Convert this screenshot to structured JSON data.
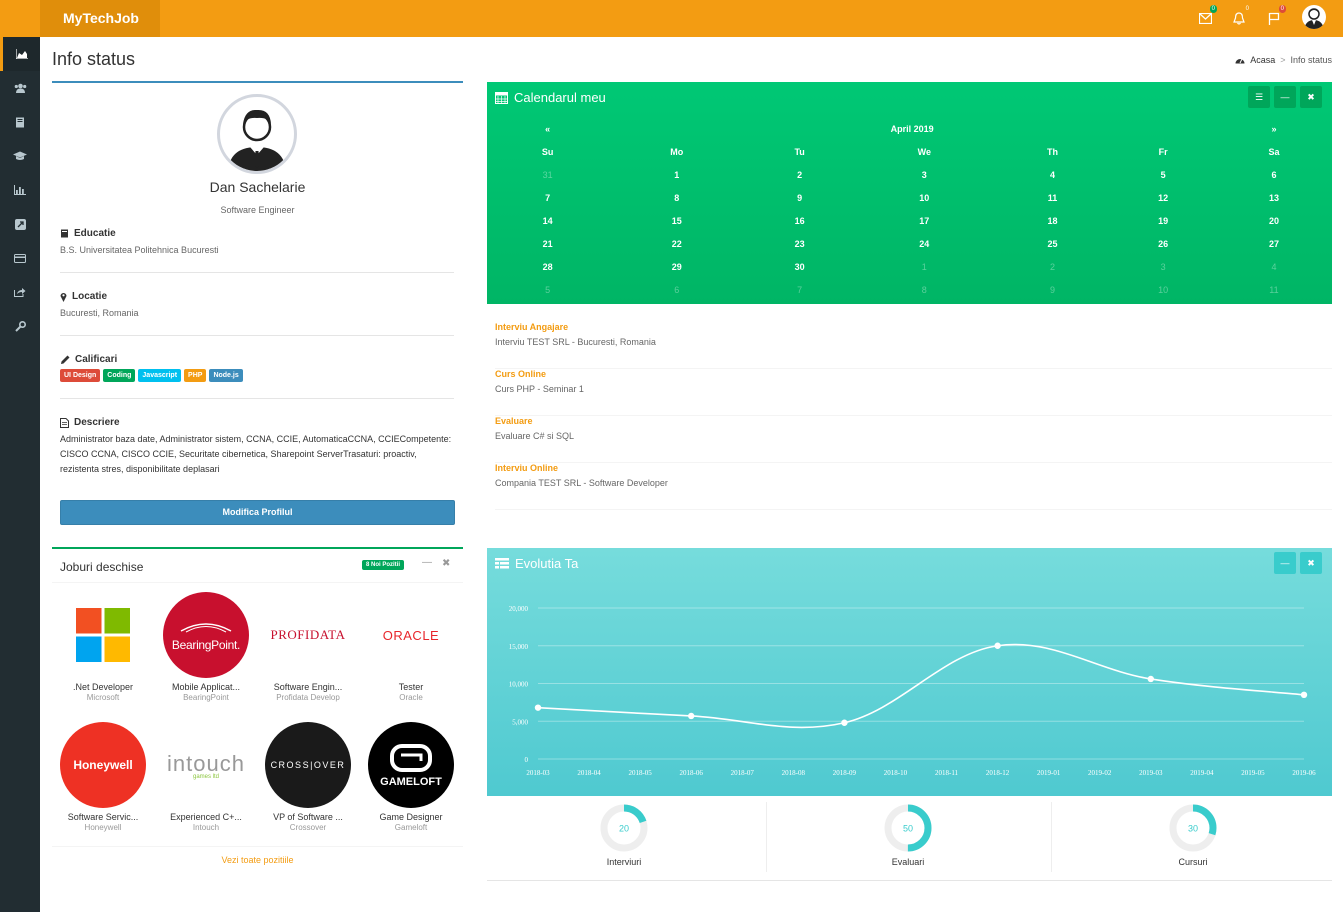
{
  "brand": "MyTechJob",
  "topbar": {
    "mail_badge": "0",
    "bell_badge": "0",
    "flag_badge": "0"
  },
  "sidebar": {
    "items": [
      "dashboard",
      "users",
      "book",
      "graduation-cap",
      "bar-chart",
      "external-link",
      "credit-card",
      "share",
      "wrench"
    ]
  },
  "page": {
    "title": "Info status",
    "breadcrumb": [
      "Acasa",
      "Info status"
    ]
  },
  "profile": {
    "name": "Dan Sachelarie",
    "role": "Software Engineer",
    "education_title": "Educatie",
    "education": "B.S. Universitatea Politehnica Bucuresti",
    "location_title": "Locatie",
    "location": "Bucuresti, Romania",
    "skills_title": "Calificari",
    "skills": [
      {
        "label": "UI Design",
        "color": "#dd4b39"
      },
      {
        "label": "Coding",
        "color": "#00a65a"
      },
      {
        "label": "Javascript",
        "color": "#00c0ef"
      },
      {
        "label": "PHP",
        "color": "#f39c12"
      },
      {
        "label": "Node.js",
        "color": "#3c8dbc"
      }
    ],
    "description_title": "Descriere",
    "description": "Administrator baza date, Administrator sistem, CCNA, CCIE, AutomaticaCCNA, CCIECompetente: CISCO CCNA, CISCO CCIE, Securitate cibernetica, Sharepoint ServerTrasaturi: proactiv, rezistenta stres, disponibilitate deplasari",
    "edit_button": "Modifica Profilul"
  },
  "jobs": {
    "title": "Joburi deschise",
    "badge": "8 Noi Pozitii",
    "footer": "Vezi toate pozitiile",
    "items": [
      {
        "title": ".Net Developer",
        "company": "Microsoft",
        "logo": "microsoft-logo"
      },
      {
        "title": "Mobile Applicat...",
        "company": "BearingPoint",
        "logo": "bearingpoint-logo",
        "logo_text": "BearingPoint."
      },
      {
        "title": "Software Engin...",
        "company": "Profidata Develop",
        "logo": "profidata-logo",
        "logo_text": "PROFIDATA"
      },
      {
        "title": "Tester",
        "company": "Oracle",
        "logo": "oracle-logo",
        "logo_text": "ORACLE"
      },
      {
        "title": "Software Servic...",
        "company": "Honeywell",
        "logo": "honeywell-logo",
        "logo_text": "Honeywell"
      },
      {
        "title": "Experienced C+...",
        "company": "Intouch",
        "logo": "intouch-logo",
        "logo_text": "intouch",
        "logo_sub": "games ltd"
      },
      {
        "title": "VP of Software ...",
        "company": "Crossover",
        "logo": "crossover-logo",
        "logo_text": "CROSS|OVER"
      },
      {
        "title": "Game Designer",
        "company": "Gameloft",
        "logo": "gameloft-logo",
        "logo_text": "GAMELOFT"
      }
    ]
  },
  "calendar": {
    "title": "Calendarul meu",
    "month": "April 2019",
    "prev": "«",
    "next": "»",
    "days": [
      "Su",
      "Mo",
      "Tu",
      "We",
      "Th",
      "Fr",
      "Sa"
    ],
    "weeks": [
      [
        [
          "31",
          true
        ],
        [
          "1",
          false
        ],
        [
          "2",
          false
        ],
        [
          "3",
          false
        ],
        [
          "4",
          false
        ],
        [
          "5",
          false
        ],
        [
          "6",
          false
        ]
      ],
      [
        [
          "7",
          false
        ],
        [
          "8",
          false
        ],
        [
          "9",
          false
        ],
        [
          "10",
          false
        ],
        [
          "11",
          false
        ],
        [
          "12",
          false
        ],
        [
          "13",
          false
        ]
      ],
      [
        [
          "14",
          false
        ],
        [
          "15",
          false
        ],
        [
          "16",
          false
        ],
        [
          "17",
          false
        ],
        [
          "18",
          false
        ],
        [
          "19",
          false
        ],
        [
          "20",
          false
        ]
      ],
      [
        [
          "21",
          false
        ],
        [
          "22",
          false
        ],
        [
          "23",
          false
        ],
        [
          "24",
          false
        ],
        [
          "25",
          false
        ],
        [
          "26",
          false
        ],
        [
          "27",
          false
        ]
      ],
      [
        [
          "28",
          false
        ],
        [
          "29",
          false
        ],
        [
          "30",
          false
        ],
        [
          "1",
          true
        ],
        [
          "2",
          true
        ],
        [
          "3",
          true
        ],
        [
          "4",
          true
        ]
      ],
      [
        [
          "5",
          true
        ],
        [
          "6",
          true
        ],
        [
          "7",
          true
        ],
        [
          "8",
          true
        ],
        [
          "9",
          true
        ],
        [
          "10",
          true
        ],
        [
          "11",
          true
        ]
      ]
    ]
  },
  "events": [
    {
      "title": "Interviu Angajare",
      "detail": "Interviu TEST SRL - Bucuresti, Romania"
    },
    {
      "title": "Curs Online",
      "detail": "Curs PHP - Seminar 1"
    },
    {
      "title": "Evaluare",
      "detail": "Evaluare C# si SQL"
    },
    {
      "title": "Interviu Online",
      "detail": "Compania TEST SRL - Software Developer"
    }
  ],
  "evolution": {
    "title": "Evolutia Ta"
  },
  "chart_data": {
    "type": "line",
    "title": "Evolutia Ta",
    "x": [
      "2018-03",
      "2018-04",
      "2018-05",
      "2018-06",
      "2018-07",
      "2018-08",
      "2018-09",
      "2018-10",
      "2018-11",
      "2018-12",
      "2019-01",
      "2019-02",
      "2019-03",
      "2019-04",
      "2019-05",
      "2019-06"
    ],
    "points": [
      {
        "x": "2018-03",
        "y": 6800
      },
      {
        "x": "2018-06",
        "y": 5700
      },
      {
        "x": "2018-09",
        "y": 4800
      },
      {
        "x": "2018-12",
        "y": 15000
      },
      {
        "x": "2019-03",
        "y": 10600
      },
      {
        "x": "2019-06",
        "y": 8500
      }
    ],
    "yticks": [
      "0",
      "5,000",
      "10,000",
      "15,000",
      "20,000"
    ],
    "ylim": [
      0,
      20000
    ],
    "grid": true,
    "color": "#ffffff"
  },
  "knobs": [
    {
      "value": 20,
      "label": "Interviuri"
    },
    {
      "value": 50,
      "label": "Evaluari"
    },
    {
      "value": 30,
      "label": "Cursuri"
    }
  ]
}
